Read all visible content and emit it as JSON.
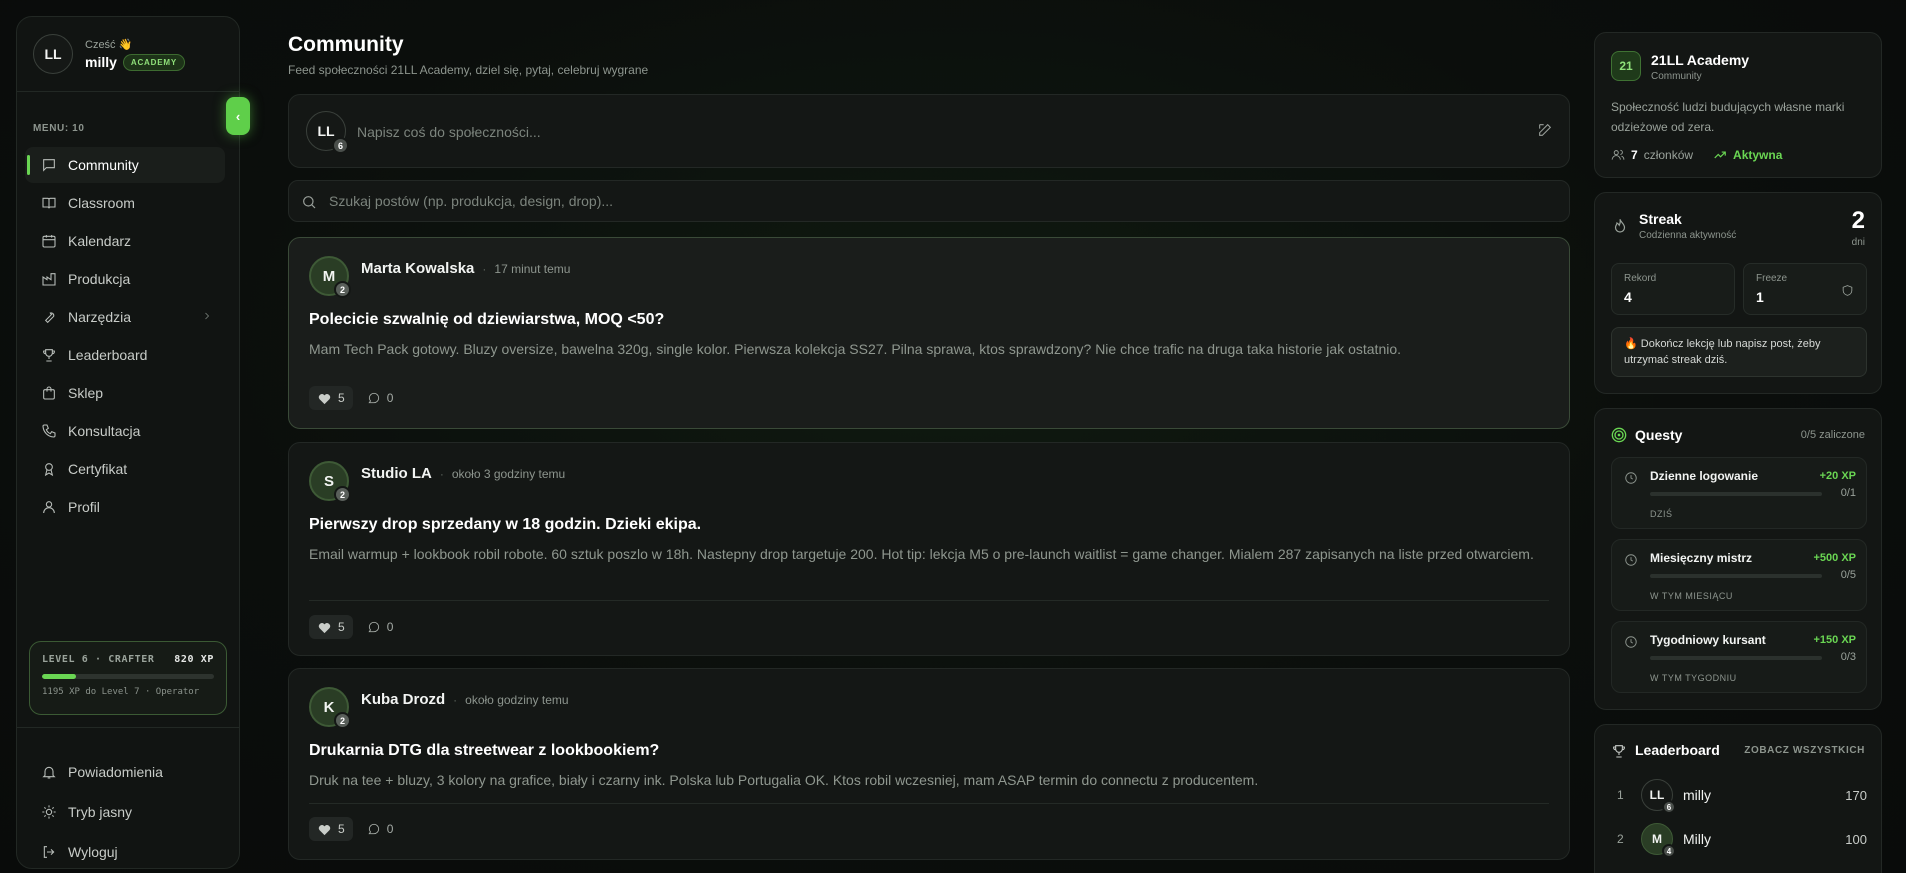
{
  "sidebar": {
    "user": {
      "initials": "LL",
      "greeting": "Cześć 👋",
      "name": "milly",
      "badge": "ACADEMY"
    },
    "menu_label": "MENU: 10",
    "items": [
      {
        "label": "Community",
        "icon": "message-icon",
        "active": true
      },
      {
        "label": "Classroom",
        "icon": "book-icon"
      },
      {
        "label": "Kalendarz",
        "icon": "calendar-icon"
      },
      {
        "label": "Produkcja",
        "icon": "factory-icon"
      },
      {
        "label": "Narzędzia",
        "icon": "wrench-icon",
        "has_submenu": true
      },
      {
        "label": "Leaderboard",
        "icon": "trophy-icon"
      },
      {
        "label": "Sklep",
        "icon": "shopping-bag-icon"
      },
      {
        "label": "Konsultacja",
        "icon": "phone-icon"
      },
      {
        "label": "Certyfikat",
        "icon": "award-icon"
      },
      {
        "label": "Profil",
        "icon": "user-icon"
      }
    ],
    "level": {
      "label": "LEVEL 6 · CRAFTER",
      "xp": "820 XP",
      "sub": "1195 XP do Level 7 · Operator",
      "progress": 0.2
    },
    "bottom": [
      {
        "label": "Powiadomienia",
        "icon": "bell-icon"
      },
      {
        "label": "Tryb jasny",
        "icon": "sun-icon"
      },
      {
        "label": "Wyloguj",
        "icon": "logout-icon"
      }
    ],
    "collapse_icon": "chevron-left-icon"
  },
  "main": {
    "title": "Community",
    "subtitle": "Feed społeczności 21LL Academy, dziel się, pytaj, celebruj wygrane",
    "composer": {
      "initials": "LL",
      "level": "6",
      "placeholder": "Napisz coś do społeczności..."
    },
    "search": {
      "placeholder": "Szukaj postów (np. produkcja, design, drop)..."
    },
    "posts": [
      {
        "initial": "M",
        "level": "2",
        "author": "Marta Kowalska",
        "time": "17 minut temu",
        "title": "Polecicie szwalnię od dziewiarstwa, MOQ <50?",
        "body": "Mam Tech Pack gotowy. Bluzy oversize, bawelna 320g, single kolor. Pierwsza kolekcja SS27. Pilna sprawa, ktos sprawdzony? Nie chce trafic na druga taka historie jak ostatnio.",
        "likes": "5",
        "comments": "0"
      },
      {
        "initial": "S",
        "level": "2",
        "author": "Studio LA",
        "time": "około 3 godziny temu",
        "title": "Pierwszy drop sprzedany w 18 godzin. Dzieki ekipa.",
        "body": "Email warmup + lookbook robil robote. 60 sztuk poszlo w 18h. Nastepny drop targetuje 200. Hot tip: lekcja M5 o pre-launch waitlist = game changer. Mialem 287 zapisanych na liste przed otwarciem.",
        "likes": "5",
        "comments": "0"
      },
      {
        "initial": "K",
        "level": "2",
        "author": "Kuba Drozd",
        "time": "około godziny temu",
        "title": "Drukarnia DTG dla streetwear z lookbookiem?",
        "body": "Druk na tee + bluzy, 3 kolory na grafice, biały i czarny ink. Polska lub Portugalia OK. Ktos robil wczesniej, mam ASAP termin do connectu z producentem.",
        "likes": "5",
        "comments": "0"
      }
    ]
  },
  "right": {
    "academy": {
      "logo": "21",
      "name": "21LL Academy",
      "type": "Community",
      "desc": "Społeczność ludzi budujących własne marki odzieżowe od zera.",
      "members_count": "7",
      "members_label": "członków",
      "status": "Aktywna"
    },
    "streak": {
      "title": "Streak",
      "sub": "Codzienna aktywność",
      "value": "2",
      "unit": "dni",
      "record_label": "Rekord",
      "record": "4",
      "freeze_label": "Freeze",
      "freeze": "1",
      "note": "🔥 Dokończ lekcję lub napisz post, żeby utrzymać streak dziś."
    },
    "quests": {
      "title": "Questy",
      "count": "0/5 zaliczone",
      "items": [
        {
          "name": "Dzienne logowanie",
          "xp": "+20 XP",
          "progress": "0/1",
          "when": "DZIŚ"
        },
        {
          "name": "Miesięczny mistrz",
          "xp": "+500 XP",
          "progress": "0/5",
          "when": "W TYM MIESIĄCU"
        },
        {
          "name": "Tygodniowy kursant",
          "xp": "+150 XP",
          "progress": "0/3",
          "when": "W TYM TYGODNIU"
        }
      ]
    },
    "leaderboard": {
      "title": "Leaderboard",
      "see_all": "ZOBACZ WSZYSTKICH",
      "rows": [
        {
          "rank": "1",
          "initials": "LL",
          "level": "6",
          "name": "milly",
          "points": "170"
        },
        {
          "rank": "2",
          "initials": "M",
          "level": "4",
          "name": "Milly",
          "points": "100"
        }
      ]
    }
  },
  "colors": {
    "accent": "#6ad653",
    "background": "#0b0e0c",
    "card": "#141715"
  }
}
